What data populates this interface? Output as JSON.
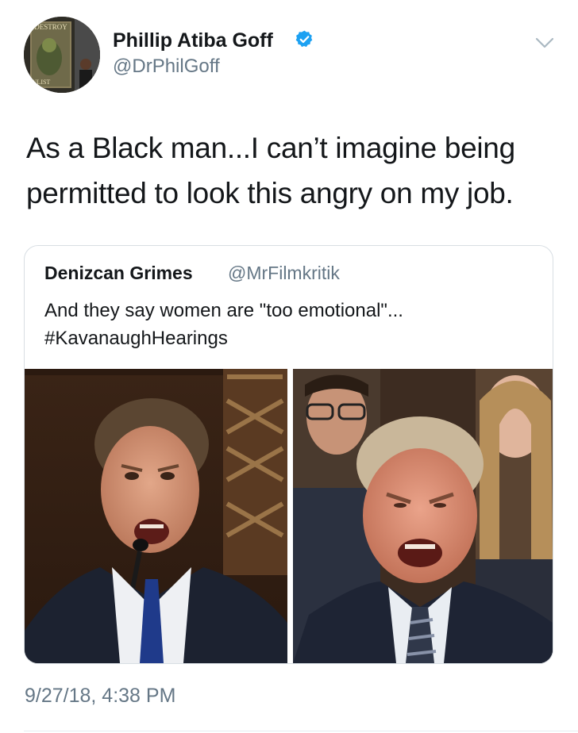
{
  "author": {
    "display_name": "Phillip Atiba Goff",
    "handle": "@DrPhilGoff",
    "verified": true,
    "avatar_icon": "avatar-photo",
    "avatar_poster_text": "DESTROY",
    "avatar_poster_text_bottom": "NLIST"
  },
  "tweet": {
    "text": "As a Black man...I can’t imagine being permitted to look this angry on my job.",
    "timestamp": "9/27/18, 4:38 PM"
  },
  "quoted_tweet": {
    "display_name": "Denizcan Grimes",
    "handle": "@MrFilmkritik",
    "text_line1": "And they say women are \"too emotional\"...",
    "text_line2": "#KavanaughHearings",
    "media": [
      {
        "icon": "photo-angry-man-microphone"
      },
      {
        "icon": "photo-angry-man-shouting"
      }
    ]
  },
  "colors": {
    "text": "#14171a",
    "secondary": "#657786",
    "verified_blue": "#1da1f2",
    "border": "#d8dee3"
  }
}
